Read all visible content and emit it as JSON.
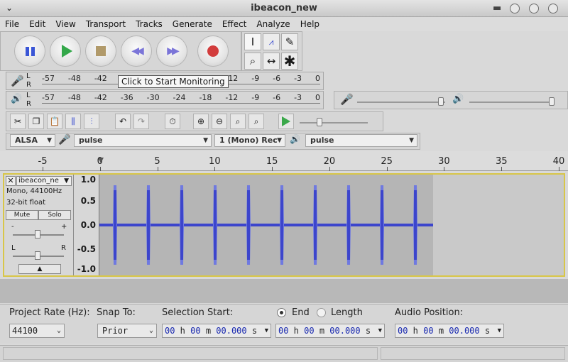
{
  "window": {
    "title": "ibeacon_new"
  },
  "menu": [
    "File",
    "Edit",
    "View",
    "Transport",
    "Tracks",
    "Generate",
    "Effect",
    "Analyze",
    "Help"
  ],
  "meters": {
    "record_ticks": [
      "-57",
      "-48",
      "-42",
      "-36",
      "-30",
      "-24",
      "-18",
      "-12",
      "-9",
      "-6",
      "-3",
      "0"
    ],
    "record_tooltip": "Click to Start Monitoring",
    "play_ticks": [
      "-57",
      "-48",
      "-42",
      "-36",
      "-30",
      "-24",
      "-18",
      "-12",
      "-9",
      "-6",
      "-3",
      "0"
    ],
    "lr": [
      "L",
      "R"
    ]
  },
  "devices": {
    "host": "ALSA",
    "input": "pulse",
    "channels": "1 (Mono) Rec",
    "output": "pulse"
  },
  "ruler": {
    "ticks": [
      "-5",
      "0",
      "5",
      "10",
      "15",
      "20",
      "25",
      "30",
      "35",
      "40"
    ]
  },
  "track": {
    "name": "ibeacon_ne",
    "info1": "Mono, 44100Hz",
    "info2": "32-bit float",
    "mute": "Mute",
    "solo": "Solo",
    "gain_minus": "-",
    "gain_plus": "+",
    "pan_l": "L",
    "pan_r": "R",
    "scale": [
      "1.0",
      "0.5",
      "0.0",
      "-0.5",
      "-1.0"
    ],
    "burst_count": 10
  },
  "selection": {
    "project_rate_label": "Project Rate (Hz):",
    "project_rate": "44100",
    "snap_label": "Snap To:",
    "snap_value": "Prior",
    "start_label": "Selection Start:",
    "end_label": "End",
    "length_label": "Length",
    "audio_pos_label": "Audio Position:",
    "time_h": "00",
    "time_m": "00",
    "time_s": "00.000"
  },
  "colors": {
    "wave": "#3c45cc",
    "wave_light": "#6f79e0",
    "accent": "#3d8f3d"
  }
}
